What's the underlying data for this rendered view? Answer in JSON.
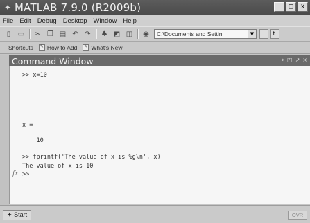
{
  "window": {
    "title": "MATLAB  7.9.0 (R2009b)"
  },
  "window_controls": [
    "_",
    "□",
    "x"
  ],
  "menu": [
    "File",
    "Edit",
    "Debug",
    "Desktop",
    "Window",
    "Help"
  ],
  "toolbar": {
    "current_directory": "C:\\Documents and Settin ",
    "browse_label": "...",
    "up_label": "t:"
  },
  "shortcuts": [
    "Shortcuts",
    "How to Add",
    "What's New"
  ],
  "command_window": {
    "title": "Command Window",
    "lines": [
      ">> x=10",
      "x =",
      "    10",
      ">> fprintf('The value of x is %g\\n', x)",
      "The value of x is 10",
      ">>"
    ],
    "fx_label": "fx"
  },
  "status": {
    "start_label": "Start",
    "ovr_label": "OVR"
  }
}
